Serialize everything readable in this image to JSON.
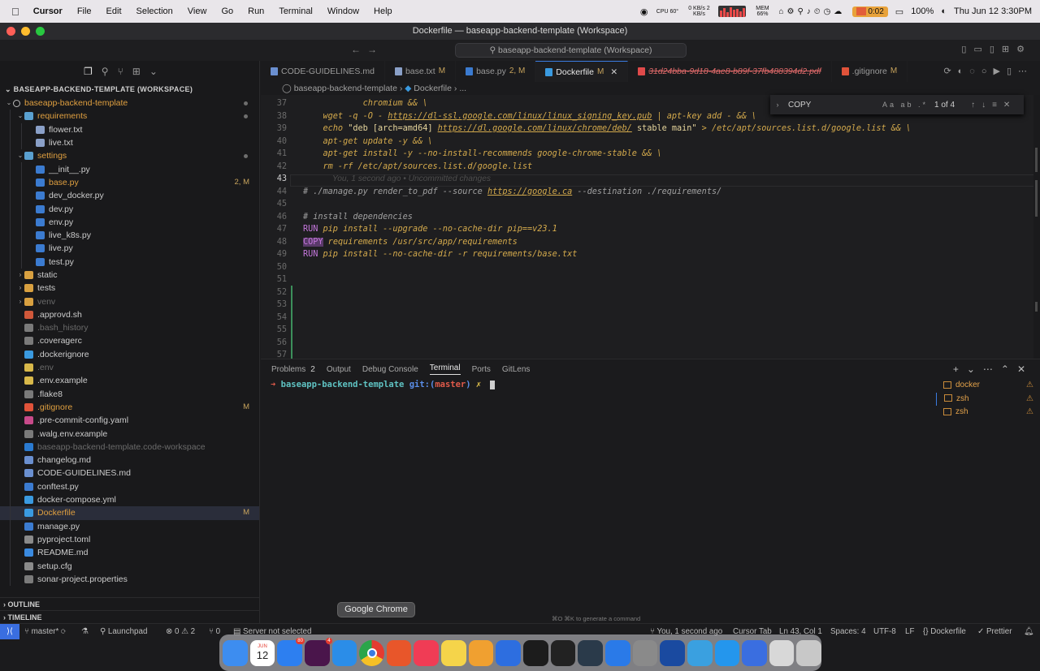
{
  "menubar": {
    "app": "Cursor",
    "items": [
      "File",
      "Edit",
      "Selection",
      "View",
      "Go",
      "Run",
      "Terminal",
      "Window",
      "Help"
    ],
    "cpu": "CPU 60°",
    "net": "0 KB/s 2 KB/s",
    "mem": "MEM 66%",
    "timer": "0:02",
    "battery": "100%",
    "datetime": "Thu Jun 12  3:30PM"
  },
  "window": {
    "title": "Dockerfile — baseapp-backend-template (Workspace)"
  },
  "commandbar": {
    "search_text": "baseapp-backend-template (Workspace)"
  },
  "sidebar": {
    "header": "BASEAPP-BACKEND-TEMPLATE (WORKSPACE)",
    "items": [
      {
        "label": "baseapp-backend-template",
        "depth": 0,
        "kind": "root",
        "color": "#e0a040"
      },
      {
        "label": "requirements",
        "depth": 1,
        "kind": "folder-open",
        "color": "#e0a040"
      },
      {
        "label": "flower.txt",
        "depth": 2,
        "kind": "txt",
        "color": "#cccccc"
      },
      {
        "label": "live.txt",
        "depth": 2,
        "kind": "txt",
        "color": "#cccccc"
      },
      {
        "label": "settings",
        "depth": 1,
        "kind": "folder-open",
        "color": "#e0a040"
      },
      {
        "label": "__init__.py",
        "depth": 2,
        "kind": "py",
        "color": "#cccccc"
      },
      {
        "label": "base.py",
        "depth": 2,
        "kind": "py",
        "color": "#e0a040",
        "badge": "2, M"
      },
      {
        "label": "dev_docker.py",
        "depth": 2,
        "kind": "py",
        "color": "#cccccc"
      },
      {
        "label": "dev.py",
        "depth": 2,
        "kind": "py",
        "color": "#cccccc"
      },
      {
        "label": "env.py",
        "depth": 2,
        "kind": "py",
        "color": "#cccccc"
      },
      {
        "label": "live_k8s.py",
        "depth": 2,
        "kind": "py",
        "color": "#cccccc"
      },
      {
        "label": "live.py",
        "depth": 2,
        "kind": "py",
        "color": "#cccccc"
      },
      {
        "label": "test.py",
        "depth": 2,
        "kind": "py",
        "color": "#cccccc"
      },
      {
        "label": "static",
        "depth": 1,
        "kind": "folder",
        "color": "#cccccc"
      },
      {
        "label": "tests",
        "depth": 1,
        "kind": "folder",
        "color": "#cccccc"
      },
      {
        "label": "venv",
        "depth": 1,
        "kind": "folder",
        "color": "#6b6b6b"
      },
      {
        "label": ".approvd.sh",
        "depth": 1,
        "kind": "sh",
        "color": "#cccccc"
      },
      {
        "label": ".bash_history",
        "depth": 1,
        "kind": "file",
        "color": "#6b6b6b"
      },
      {
        "label": ".coveragerc",
        "depth": 1,
        "kind": "file",
        "color": "#cccccc"
      },
      {
        "label": ".dockerignore",
        "depth": 1,
        "kind": "docker",
        "color": "#cccccc"
      },
      {
        "label": ".env",
        "depth": 1,
        "kind": "env",
        "color": "#6b6b6b"
      },
      {
        "label": ".env.example",
        "depth": 1,
        "kind": "env",
        "color": "#cccccc"
      },
      {
        "label": ".flake8",
        "depth": 1,
        "kind": "file",
        "color": "#cccccc"
      },
      {
        "label": ".gitignore",
        "depth": 1,
        "kind": "git",
        "color": "#e0a040",
        "badge": "M"
      },
      {
        "label": ".pre-commit-config.yaml",
        "depth": 1,
        "kind": "yaml",
        "color": "#cccccc"
      },
      {
        "label": ".walg.env.example",
        "depth": 1,
        "kind": "file",
        "color": "#cccccc"
      },
      {
        "label": "baseapp-backend-template.code-workspace",
        "depth": 1,
        "kind": "vscode",
        "color": "#6b6b6b"
      },
      {
        "label": "changelog.md",
        "depth": 1,
        "kind": "md",
        "color": "#cccccc"
      },
      {
        "label": "CODE-GUIDELINES.md",
        "depth": 1,
        "kind": "md",
        "color": "#cccccc"
      },
      {
        "label": "conftest.py",
        "depth": 1,
        "kind": "py",
        "color": "#cccccc"
      },
      {
        "label": "docker-compose.yml",
        "depth": 1,
        "kind": "docker",
        "color": "#cccccc"
      },
      {
        "label": "Dockerfile",
        "depth": 1,
        "kind": "docker",
        "color": "#e0a040",
        "badge": "M",
        "selected": true
      },
      {
        "label": "manage.py",
        "depth": 1,
        "kind": "py",
        "color": "#cccccc"
      },
      {
        "label": "pyproject.toml",
        "depth": 1,
        "kind": "toml",
        "color": "#cccccc"
      },
      {
        "label": "README.md",
        "depth": 1,
        "kind": "info",
        "color": "#cccccc"
      },
      {
        "label": "setup.cfg",
        "depth": 1,
        "kind": "cfg",
        "color": "#cccccc"
      },
      {
        "label": "sonar-project.properties",
        "depth": 1,
        "kind": "file",
        "color": "#cccccc"
      }
    ],
    "outline": "OUTLINE",
    "timeline": "TIMELINE"
  },
  "tabs": [
    {
      "label": "CODE-GUIDELINES.md",
      "mod": "",
      "kind": "md"
    },
    {
      "label": "base.txt",
      "mod": "M",
      "kind": "txt"
    },
    {
      "label": "base.py",
      "mod": "2, M",
      "kind": "py"
    },
    {
      "label": "Dockerfile",
      "mod": "M",
      "kind": "docker",
      "active": true
    },
    {
      "label": "31d24bba-9d18-4ae8-b89f-37fb488394d2.pdf",
      "mod": "",
      "kind": "pdf",
      "deleted": true
    },
    {
      "label": ".gitignore",
      "mod": "M",
      "kind": "git"
    }
  ],
  "breadcrumb": {
    "root": "baseapp-backend-template",
    "file": "Dockerfile",
    "more": "..."
  },
  "find": {
    "query": "COPY",
    "opts": "Aa ab .*",
    "count": "1 of 4"
  },
  "editor": {
    "lines": [
      {
        "n": "37",
        "text": "    chromium && \\"
      },
      {
        "n": "38",
        "text": "wget -q -O - https://dl-ssl.google.com/linux/linux_signing_key.pub | apt-key add - && \\"
      },
      {
        "n": "39",
        "text": "echo \"deb [arch=amd64] https://dl.google.com/linux/chrome/deb/ stable main\" > /etc/apt/sources.list.d/google.list && \\"
      },
      {
        "n": "40",
        "text": "apt-get update -y && \\"
      },
      {
        "n": "41",
        "text": "apt-get install -y --no-install-recommends google-chrome-stable && \\"
      },
      {
        "n": "42",
        "text": "rm -rf /etc/apt/sources.list.d/google.list"
      },
      {
        "n": "43",
        "text": "You, 1 second ago • Uncommitted changes"
      },
      {
        "n": "44",
        "text": "# ./manage.py render_to_pdf --source https://google.ca --destination ./requirements/"
      },
      {
        "n": "45",
        "text": ""
      },
      {
        "n": "46",
        "text": "# install dependencies"
      },
      {
        "n": "47",
        "text": "RUN pip install --upgrade --no-cache-dir pip==v23.1"
      },
      {
        "n": "48",
        "text": "COPY requirements /usr/src/app/requirements"
      },
      {
        "n": "49",
        "text": "RUN pip install --no-cache-dir -r requirements/base.txt"
      },
      {
        "n": "50",
        "text": ""
      },
      {
        "n": "51",
        "text": ""
      },
      {
        "n": "52",
        "text": ""
      },
      {
        "n": "53",
        "text": ""
      },
      {
        "n": "54",
        "text": ""
      },
      {
        "n": "55",
        "text": ""
      },
      {
        "n": "56",
        "text": ""
      },
      {
        "n": "57",
        "text": ""
      }
    ],
    "url38": "https://dl-ssl.google.com/linux/linux_signing_key.pub",
    "url39": "https://dl.google.com/linux/chrome/deb/",
    "url44": "https://google.ca"
  },
  "panel": {
    "tabs": [
      "Problems",
      "Output",
      "Debug Console",
      "Terminal",
      "Ports",
      "GitLens"
    ],
    "problems_count": "2",
    "active": "Terminal",
    "prompt": {
      "arrow": "➜",
      "dir": "baseapp-backend-template",
      "git": "git:(",
      "branch": "master",
      "git_close": ")",
      "x": "✗"
    },
    "terminals": [
      {
        "label": "docker",
        "selected": false
      },
      {
        "label": "zsh",
        "selected": true
      },
      {
        "label": "zsh",
        "selected": false
      }
    ],
    "hint": "⌘O ⌘K to generate a command"
  },
  "status": {
    "branch": "master*",
    "launchpad": "Launchpad",
    "errors": "0",
    "warnings": "2",
    "ports": "0",
    "server": "Server not selected",
    "blame": "You, 1 second ago",
    "cursor_tab": "Cursor Tab",
    "position": "Ln 43, Col 1",
    "spaces": "Spaces: 4",
    "encoding": "UTF-8",
    "eol": "LF",
    "lang": "Dockerfile",
    "prettier": "Prettier"
  },
  "dock": {
    "tooltip": "Google Chrome",
    "calendar_month": "JUN",
    "calendar_day": "12",
    "apps": [
      {
        "name": "finder",
        "color": "#3d8df0"
      },
      {
        "name": "calendar",
        "color": "#ffffff"
      },
      {
        "name": "app-store",
        "color": "#2d7ff0",
        "badge": "80"
      },
      {
        "name": "slack",
        "color": "#4a154b",
        "badge": "4"
      },
      {
        "name": "safari",
        "color": "#2b8de8"
      },
      {
        "name": "chrome",
        "color": "#ffffff"
      },
      {
        "name": "firefox",
        "color": "#e8562a"
      },
      {
        "name": "music",
        "color": "#f03c55"
      },
      {
        "name": "notes",
        "color": "#f5d44a"
      },
      {
        "name": "photos",
        "color": "#f0a030"
      },
      {
        "name": "xcode",
        "color": "#2d6ee0"
      },
      {
        "name": "cursor",
        "color": "#1c1c1c"
      },
      {
        "name": "terminal",
        "color": "#222222"
      },
      {
        "name": "lab",
        "color": "#2a3a4a"
      },
      {
        "name": "tasks",
        "color": "#2a7ae8"
      },
      {
        "name": "settings",
        "color": "#8a8a8a"
      },
      {
        "name": "bitwarden",
        "color": "#1a4aa0"
      },
      {
        "name": "sourcetree",
        "color": "#3aa0e0"
      },
      {
        "name": "docker",
        "color": "#2496ed"
      },
      {
        "name": "translate",
        "color": "#3a6ee0"
      },
      {
        "name": "preview",
        "color": "#d8d8d8"
      },
      {
        "name": "trash",
        "color": "#c8c8c8"
      }
    ]
  }
}
